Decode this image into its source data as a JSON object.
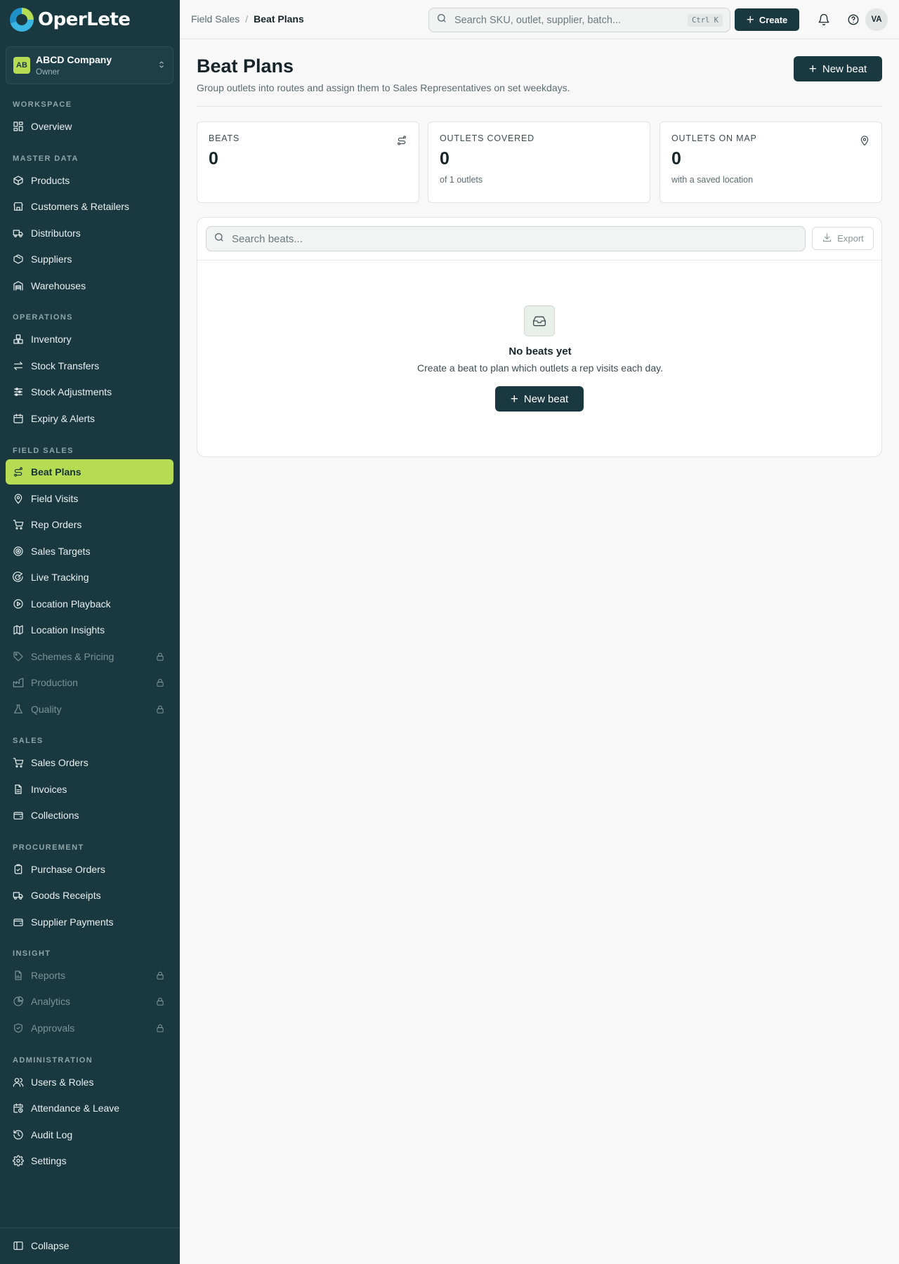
{
  "app": {
    "name": "OperLete"
  },
  "org": {
    "initials": "AB",
    "name": "ABCD Company",
    "role": "Owner"
  },
  "sidebar": {
    "sections": [
      {
        "label": "WORKSPACE"
      },
      {
        "label": "MASTER DATA"
      },
      {
        "label": "OPERATIONS"
      },
      {
        "label": "FIELD SALES"
      },
      {
        "label": "SALES"
      },
      {
        "label": "PROCUREMENT"
      },
      {
        "label": "INSIGHT"
      },
      {
        "label": "ADMINISTRATION"
      }
    ],
    "items": [
      {
        "label": "Overview",
        "icon": "grid-icon"
      },
      {
        "label": "Products",
        "icon": "box-icon"
      },
      {
        "label": "Customers & Retailers",
        "icon": "store-icon"
      },
      {
        "label": "Distributors",
        "icon": "truck-icon"
      },
      {
        "label": "Suppliers",
        "icon": "package-icon"
      },
      {
        "label": "Warehouses",
        "icon": "warehouse-icon"
      },
      {
        "label": "Inventory",
        "icon": "boxes-icon"
      },
      {
        "label": "Stock Transfers",
        "icon": "arrows-icon"
      },
      {
        "label": "Stock Adjustments",
        "icon": "sliders-icon"
      },
      {
        "label": "Expiry & Alerts",
        "icon": "calendar-icon"
      },
      {
        "label": "Beat Plans",
        "icon": "route-icon",
        "active": true
      },
      {
        "label": "Field Visits",
        "icon": "map-pin-icon"
      },
      {
        "label": "Rep Orders",
        "icon": "cart-icon"
      },
      {
        "label": "Sales Targets",
        "icon": "target-icon"
      },
      {
        "label": "Live Tracking",
        "icon": "radar-icon"
      },
      {
        "label": "Location Playback",
        "icon": "play-circle-icon"
      },
      {
        "label": "Location Insights",
        "icon": "map-icon"
      },
      {
        "label": "Schemes & Pricing",
        "icon": "tag-icon",
        "locked": true
      },
      {
        "label": "Production",
        "icon": "factory-icon",
        "locked": true
      },
      {
        "label": "Quality",
        "icon": "flask-icon",
        "locked": true
      },
      {
        "label": "Sales Orders",
        "icon": "cart-icon"
      },
      {
        "label": "Invoices",
        "icon": "file-icon"
      },
      {
        "label": "Collections",
        "icon": "wallet-icon"
      },
      {
        "label": "Purchase Orders",
        "icon": "clipboard-icon"
      },
      {
        "label": "Goods Receipts",
        "icon": "truck-icon"
      },
      {
        "label": "Supplier Payments",
        "icon": "wallet-icon"
      },
      {
        "label": "Reports",
        "icon": "report-icon",
        "locked": true
      },
      {
        "label": "Analytics",
        "icon": "pie-icon",
        "locked": true
      },
      {
        "label": "Approvals",
        "icon": "shield-check-icon",
        "locked": true
      },
      {
        "label": "Users & Roles",
        "icon": "users-icon"
      },
      {
        "label": "Attendance & Leave",
        "icon": "calendar-clock-icon"
      },
      {
        "label": "Audit Log",
        "icon": "history-icon"
      },
      {
        "label": "Settings",
        "icon": "gear-icon"
      }
    ],
    "collapse_label": "Collapse"
  },
  "topbar": {
    "breadcrumb": [
      "Field Sales",
      "Beat Plans"
    ],
    "breadcrumb_sep": "/",
    "search_placeholder": "Search SKU, outlet, supplier, batch...",
    "search_shortcut": "Ctrl K",
    "create_label": "Create",
    "avatar_initials": "VA"
  },
  "page": {
    "title": "Beat Plans",
    "subtitle": "Group outlets into routes and assign them to Sales Representatives on set weekdays.",
    "new_beat_label": "New beat"
  },
  "stats": [
    {
      "label": "BEATS",
      "value": "0",
      "note": "",
      "icon": "route-icon"
    },
    {
      "label": "OUTLETS COVERED",
      "value": "0",
      "note": "of 1 outlets",
      "icon": ""
    },
    {
      "label": "OUTLETS ON MAP",
      "value": "0",
      "note": "with a saved location",
      "icon": "map-pin-icon"
    }
  ],
  "beats": {
    "search_placeholder": "Search beats...",
    "export_label": "Export",
    "empty_title": "No beats yet",
    "empty_subtitle": "Create a beat to plan which outlets a rep visits each day.",
    "empty_button": "New beat"
  },
  "colors": {
    "sidebar_bg": "#1a3840",
    "accent": "#b6dc53",
    "primary_btn": "#1a3840"
  }
}
